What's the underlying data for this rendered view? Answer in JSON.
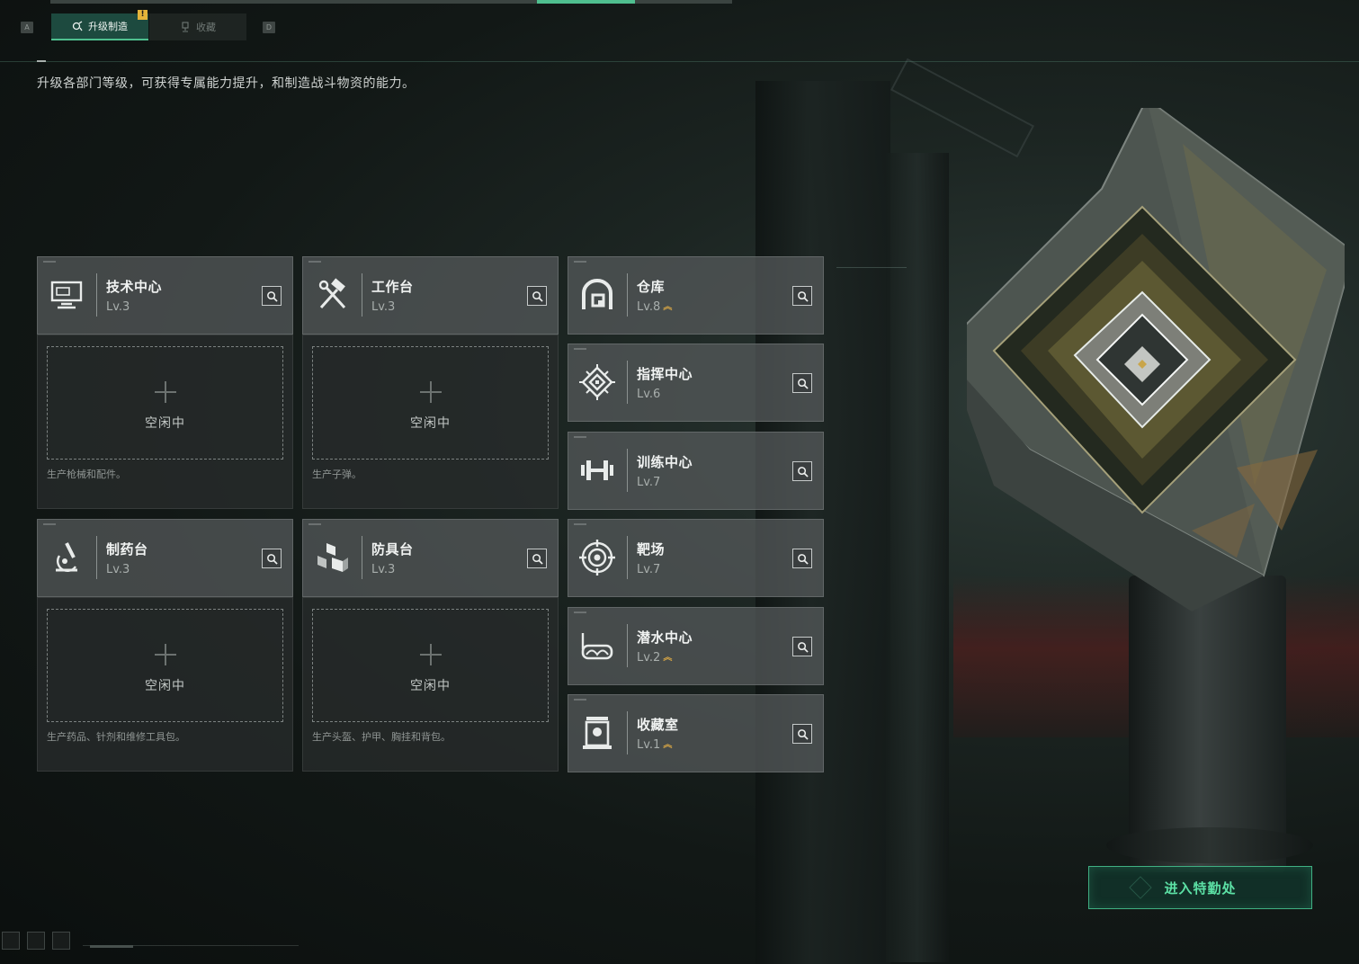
{
  "header": {
    "left_key": "A",
    "right_key": "D",
    "tabs": [
      {
        "label": "升级制造",
        "active": true,
        "icon": "gear-hammer-icon"
      },
      {
        "label": "收藏",
        "active": false,
        "icon": "trophy-icon"
      }
    ],
    "notice_badge": "!"
  },
  "description": "升级各部门等级，可获得专属能力提升，和制造战斗物资的能力。",
  "crafting_departments": [
    {
      "name": "技术中心",
      "level": "Lv.3",
      "icon": "computer-icon",
      "slot_status": "空闲中",
      "produces": "生产枪械和配件。"
    },
    {
      "name": "工作台",
      "level": "Lv.3",
      "icon": "hammer-wrench-icon",
      "slot_status": "空闲中",
      "produces": "生产子弹。"
    },
    {
      "name": "制药台",
      "level": "Lv.3",
      "icon": "microscope-icon",
      "slot_status": "空闲中",
      "produces": "生产药品、针剂和维修工具包。"
    },
    {
      "name": "防具台",
      "level": "Lv.3",
      "icon": "cubes-icon",
      "slot_status": "空闲中",
      "produces": "生产头盔、护甲、胸挂和背包。"
    }
  ],
  "facilities": [
    {
      "name": "仓库",
      "level": "Lv.8",
      "upgradable": true,
      "icon": "warehouse-icon"
    },
    {
      "name": "指挥中心",
      "level": "Lv.6",
      "upgradable": false,
      "icon": "command-chip-icon"
    },
    {
      "name": "训练中心",
      "level": "Lv.7",
      "upgradable": false,
      "icon": "dumbbell-icon"
    },
    {
      "name": "靶场",
      "level": "Lv.7",
      "upgradable": false,
      "icon": "target-icon"
    },
    {
      "name": "潜水中心",
      "level": "Lv.2",
      "upgradable": true,
      "icon": "diving-mask-icon"
    },
    {
      "name": "收藏室",
      "level": "Lv.1",
      "upgradable": true,
      "icon": "display-case-icon"
    }
  ],
  "enter_button": "进入特勤处",
  "colors": {
    "accent_green": "#4fbf8f",
    "upgrade_gold": "#d9a745",
    "notice_yellow": "#e3b43a"
  }
}
